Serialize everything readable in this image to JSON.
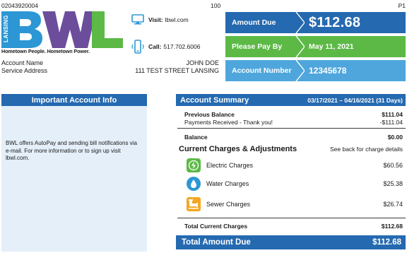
{
  "header": {
    "account_code": "02043920004",
    "page_count": "100",
    "page_number": "P1"
  },
  "logo": {
    "vertical_text": "LANSING",
    "letters": "BWL",
    "tagline": "Hometown People. Hometown Power.",
    "colors": {
      "blue": "#2c97d4",
      "green": "#5cb946",
      "purple": "#6b4d9c"
    }
  },
  "contact": {
    "visit_label": "Visit:",
    "visit_value": "lbwl.com",
    "call_label": "Call:",
    "call_value": "517.702.6006"
  },
  "account": {
    "name_label": "Account Name",
    "name_value": "JOHN DOE",
    "address_label": "Service Address",
    "address_value": "111 TEST STREET LANSING"
  },
  "payment": {
    "amount_due_label": "Amount Due",
    "amount_due_value": "$112.68",
    "pay_by_label": "Please Pay By",
    "pay_by_value": "May 11, 2021",
    "account_number_label": "Account Number",
    "account_number_value": "12345678"
  },
  "important": {
    "title": "Important Account Info",
    "text": "BWL offers AutoPay and sending bill notifications via e-mail. For more information or to sign up visit lbwl.com."
  },
  "summary": {
    "title": "Account Summary",
    "date_range": "03/17/2021 – 04/16/2021 (31 Days)",
    "previous_balance_label": "Previous Balance",
    "previous_balance_value": "$111.04",
    "payments_label": "Payments Received - Thank you!",
    "payments_value": "-$111.04",
    "balance_label": "Balance",
    "balance_value": "$0.00",
    "current_charges_title": "Current Charges & Adjustments",
    "current_charges_note": "See back for charge details",
    "charges": [
      {
        "icon": "lightning-icon",
        "label": "Electric Charges",
        "value": "$60.56"
      },
      {
        "icon": "water-drop-icon",
        "label": "Water Charges",
        "value": "$25.38"
      },
      {
        "icon": "pipe-icon",
        "label": "Sewer Charges",
        "value": "$26.74"
      }
    ],
    "total_current_label": "Total Current Charges",
    "total_current_value": "$112.68",
    "total_due_label": "Total Amount Due",
    "total_due_value": "$112.68"
  }
}
